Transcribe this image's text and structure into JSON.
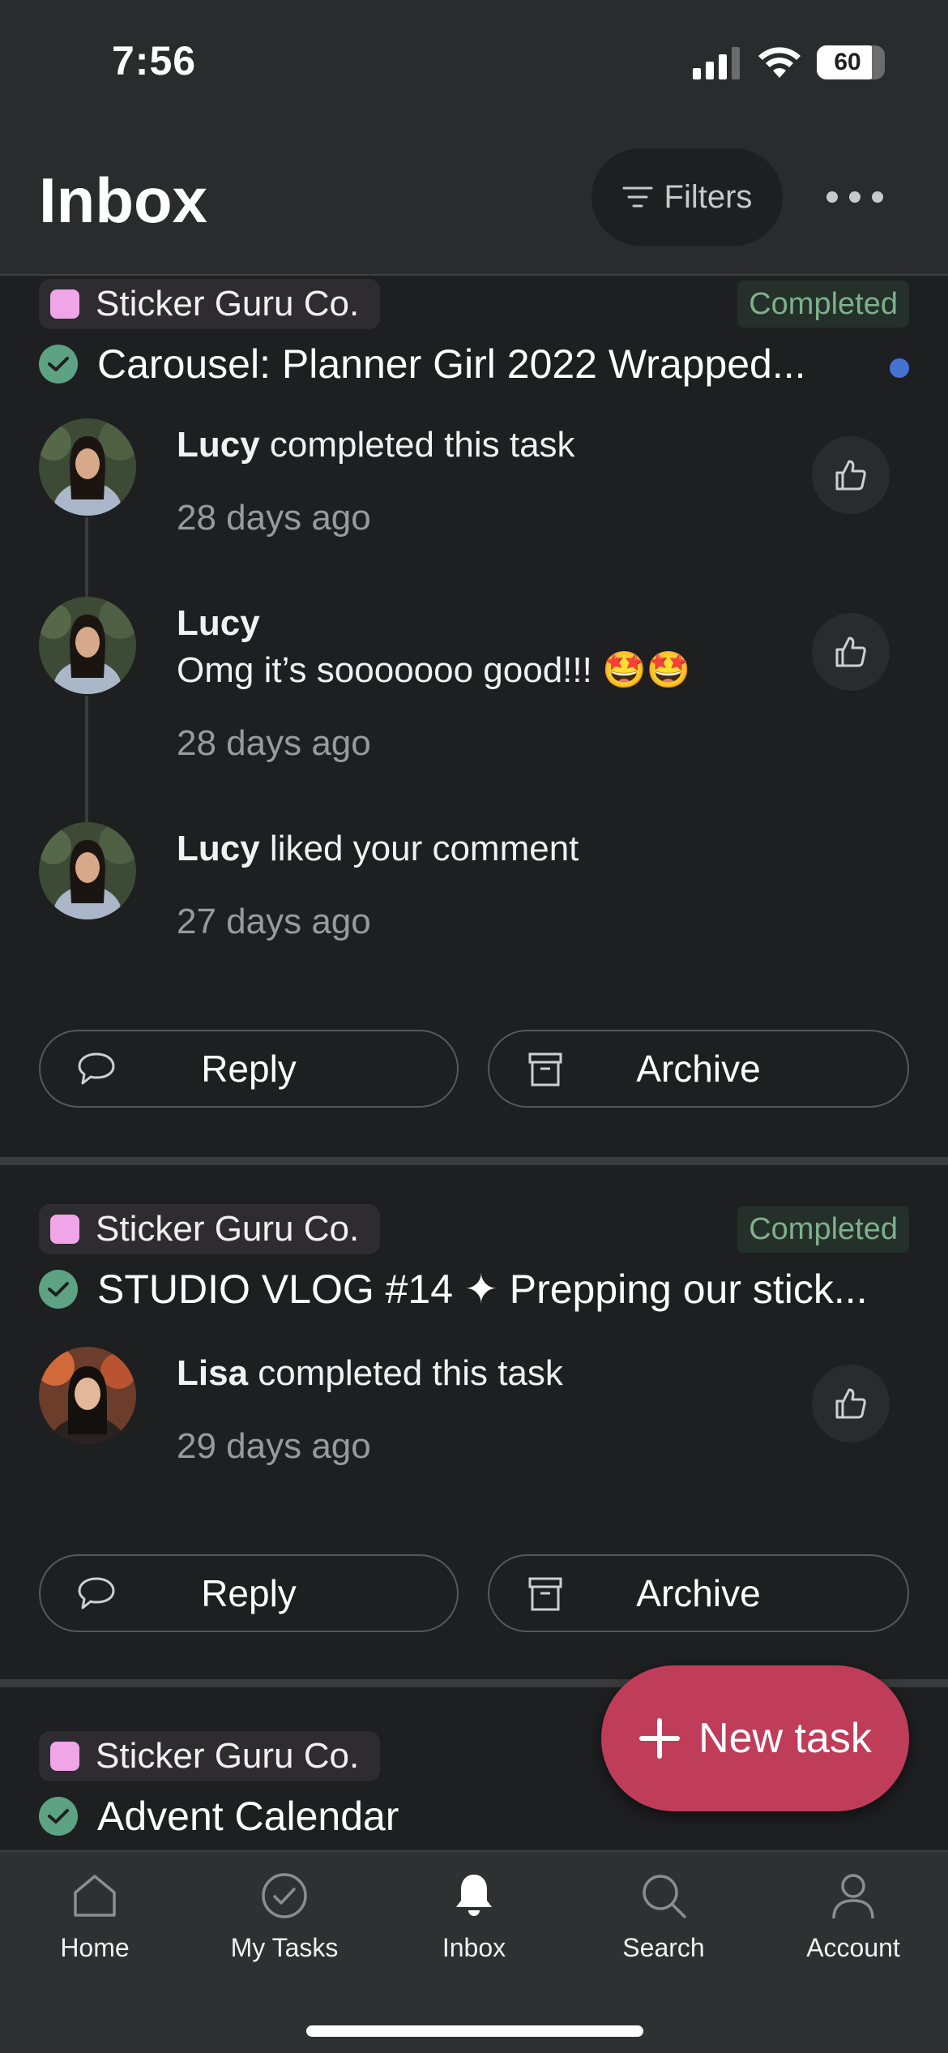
{
  "status_bar": {
    "time": "7:56",
    "battery": "60"
  },
  "header": {
    "title": "Inbox",
    "filters_label": "Filters"
  },
  "cards": [
    {
      "project": "Sticker Guru Co.",
      "status": "Completed",
      "task_title": "Carousel: Planner Girl 2022 Wrapped...",
      "activities": [
        {
          "user": "Lucy",
          "action": " completed this task",
          "comment": "",
          "time": "28 days ago"
        },
        {
          "user": "Lucy",
          "action": "",
          "comment": "Omg it’s sooooooo good!!! 🤩🤩",
          "time": "28 days ago"
        },
        {
          "user": "Lucy",
          "action": " liked your comment",
          "comment": "",
          "time": "27 days ago"
        }
      ],
      "reply_label": "Reply",
      "archive_label": "Archive"
    },
    {
      "project": "Sticker Guru Co.",
      "status": "Completed",
      "task_title": "STUDIO VLOG #14 ✦ Prepping our stick...",
      "activities": [
        {
          "user": "Lisa",
          "action": " completed this task",
          "comment": "",
          "time": "29 days ago"
        }
      ],
      "reply_label": "Reply",
      "archive_label": "Archive"
    },
    {
      "project": "Sticker Guru Co.",
      "task_title": "Advent Calendar"
    }
  ],
  "fab": {
    "label": "New task"
  },
  "tabbar": {
    "items": [
      {
        "label": "Home",
        "icon": "home-icon"
      },
      {
        "label": "My Tasks",
        "icon": "check-circle-icon"
      },
      {
        "label": "Inbox",
        "icon": "bell-icon"
      },
      {
        "label": "Search",
        "icon": "search-icon"
      },
      {
        "label": "Account",
        "icon": "person-icon"
      }
    ]
  },
  "colors": {
    "accent": "#c03d5a",
    "completed": "#5da283",
    "project": "#efa5e8",
    "unread": "#4573d2"
  }
}
